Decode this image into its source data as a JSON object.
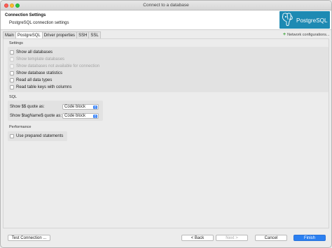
{
  "window": {
    "title": "Connect to a database"
  },
  "header": {
    "title": "Connection Settings",
    "subtitle": "PostgreSQL connection settings",
    "logo_text": "PostgreSQL"
  },
  "tabs": [
    {
      "label": "Main"
    },
    {
      "label": "PostgreSQL"
    },
    {
      "label": "Driver properties"
    },
    {
      "label": "SSH"
    },
    {
      "label": "SSL"
    }
  ],
  "active_tab": "PostgreSQL",
  "network_config": {
    "label": "Network configurations..."
  },
  "settings": {
    "label": "Settings",
    "options": [
      {
        "label": "Show all databases",
        "checked": false,
        "enabled": true
      },
      {
        "label": "Show template databases",
        "checked": false,
        "enabled": false
      },
      {
        "label": "Show databases not available for connection",
        "checked": false,
        "enabled": false
      },
      {
        "label": "Show database statistics",
        "checked": false,
        "enabled": true
      },
      {
        "label": "Read all data types",
        "checked": false,
        "enabled": true
      },
      {
        "label": "Read table keys with columns",
        "checked": false,
        "enabled": true
      }
    ]
  },
  "sql": {
    "label": "SQL",
    "rows": [
      {
        "label": "Show $$ quote as:",
        "value": "Code block"
      },
      {
        "label": "Show $tagName$ quote as:",
        "value": "Code block"
      }
    ]
  },
  "performance": {
    "label": "Performance",
    "options": [
      {
        "label": "Use prepared statements",
        "checked": false
      }
    ]
  },
  "footer": {
    "test_connection": "Test Connection ...",
    "back": "< Back",
    "next": "Next >",
    "cancel": "Cancel",
    "finish": "Finish"
  },
  "colors": {
    "accent": "#2b7ff0",
    "logo_bg": "#1e8ab3",
    "close": "#fd5f57",
    "minimize": "#fcbb2e",
    "maximize": "#29c840"
  },
  "icons": [
    "close-window-icon",
    "minimize-window-icon",
    "maximize-window-icon",
    "postgresql-elephant-icon",
    "add-icon",
    "dropdown-arrows-icon"
  ]
}
